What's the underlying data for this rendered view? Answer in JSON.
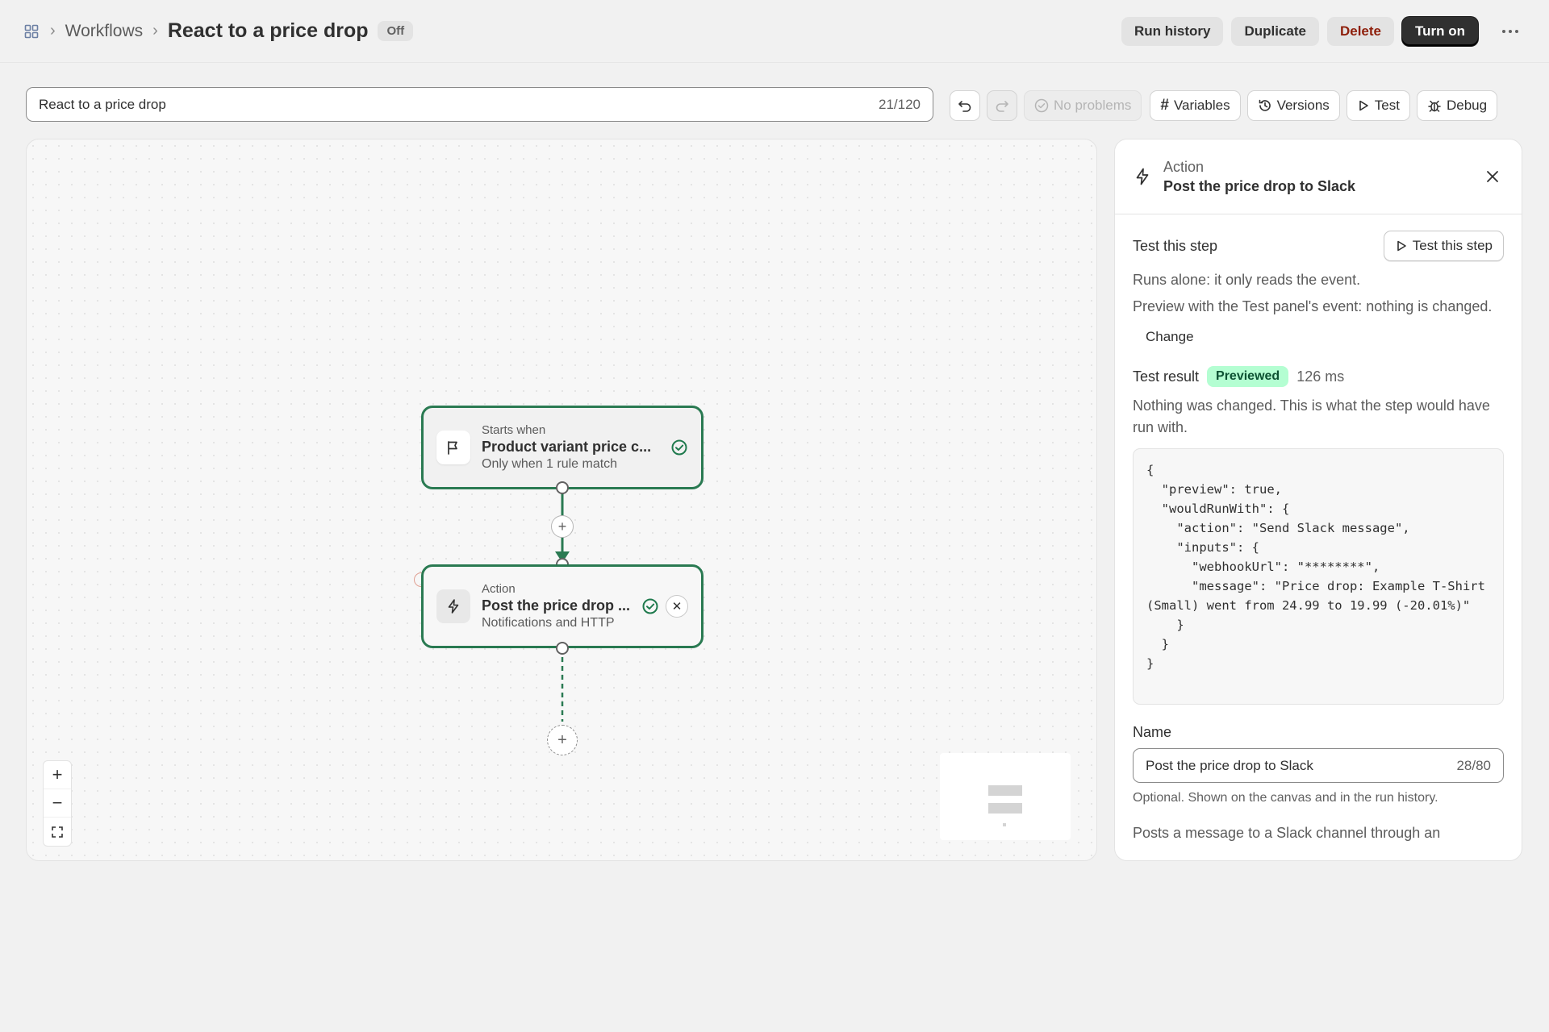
{
  "header": {
    "breadcrumb_parent": "Workflows",
    "title": "React to a price drop",
    "status": "Off",
    "buttons": {
      "run_history": "Run history",
      "duplicate": "Duplicate",
      "delete": "Delete",
      "turn_on": "Turn on"
    }
  },
  "name_bar": {
    "value": "React to a price drop",
    "count": "21/120"
  },
  "toolbar": {
    "problems": "No problems",
    "variables": "Variables",
    "versions": "Versions",
    "test": "Test",
    "debug": "Debug"
  },
  "canvas": {
    "trigger": {
      "kicker": "Starts when",
      "title": "Product variant price c...",
      "subtitle": "Only when 1 rule match"
    },
    "action": {
      "kicker": "Action",
      "title": "Post the price drop ...",
      "subtitle": "Notifications and HTTP"
    },
    "zoom": {
      "in": "+",
      "out": "−"
    }
  },
  "panel": {
    "kicker": "Action",
    "title": "Post the price drop to Slack",
    "test_step": {
      "title": "Test this step",
      "button": "Test this step",
      "line1": "Runs alone: it only reads the event.",
      "line2": "Preview with the Test panel's event: nothing is changed.",
      "change": "Change"
    },
    "result": {
      "label": "Test result",
      "badge": "Previewed",
      "duration": "126 ms",
      "note": "Nothing was changed. This is what the step would have run with.",
      "code": "{\n  \"preview\": true,\n  \"wouldRunWith\": {\n    \"action\": \"Send Slack message\",\n    \"inputs\": {\n      \"webhookUrl\": \"********\",\n      \"message\": \"Price drop: Example T-Shirt (Small) went from 24.99 to 19.99 (-20.01%)\"\n    }\n  }\n}"
    },
    "name_field": {
      "label": "Name",
      "value": "Post the price drop to Slack",
      "count": "28/80",
      "help": "Optional. Shown on the canvas and in the run history."
    },
    "description": "Posts a message to a Slack channel through an"
  },
  "colors": {
    "node_border": "#2a7a52",
    "success": "#1f7a4d",
    "badge_green_bg": "#b4fed2",
    "delete_text": "#8e1f0b",
    "primary_dark": "#303030"
  }
}
